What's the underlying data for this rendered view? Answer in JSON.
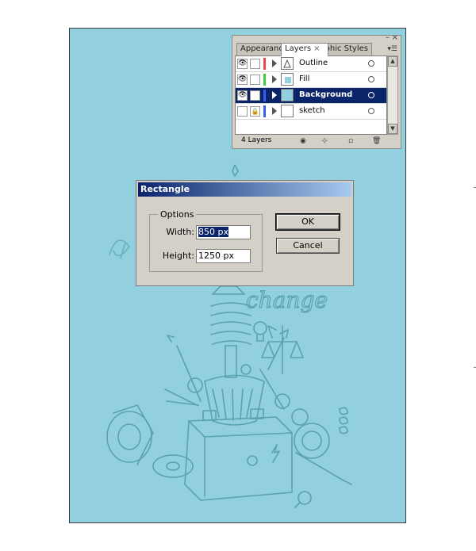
{
  "layers_panel": {
    "tabs": [
      {
        "label": "Appearance"
      },
      {
        "label": "Layers",
        "close": "×"
      },
      {
        "label": "Graphic Styles"
      }
    ],
    "layers": [
      {
        "name": "Outline",
        "visible": true,
        "locked": false,
        "color": "#e84a4a",
        "selected": false
      },
      {
        "name": "Fill",
        "visible": true,
        "locked": false,
        "color": "#3ccf3c",
        "selected": false
      },
      {
        "name": "Background",
        "visible": true,
        "locked": false,
        "color": "#3a5cf0",
        "selected": true
      },
      {
        "name": "sketch",
        "visible": false,
        "locked": true,
        "color": "#3a5cf0",
        "selected": false
      }
    ],
    "count_label": "4 Layers",
    "footer_icons": [
      "make-clipping-mask-icon",
      "create-sublayer-icon",
      "new-layer-icon",
      "delete-layer-icon"
    ]
  },
  "dialog": {
    "title": "Rectangle",
    "options_legend": "Options",
    "width_label": "Width:",
    "width_value": "850 px",
    "height_label": "Height:",
    "height_value": "1250 px",
    "ok_label": "OK",
    "cancel_label": "Cancel"
  },
  "artwork": {
    "text": "change",
    "background": "#92d0e0",
    "line_color": "#5aa2ae"
  },
  "colors": {
    "titlebar_start": "#0a246a",
    "titlebar_end": "#a6caf0",
    "selection": "#0a246a"
  }
}
